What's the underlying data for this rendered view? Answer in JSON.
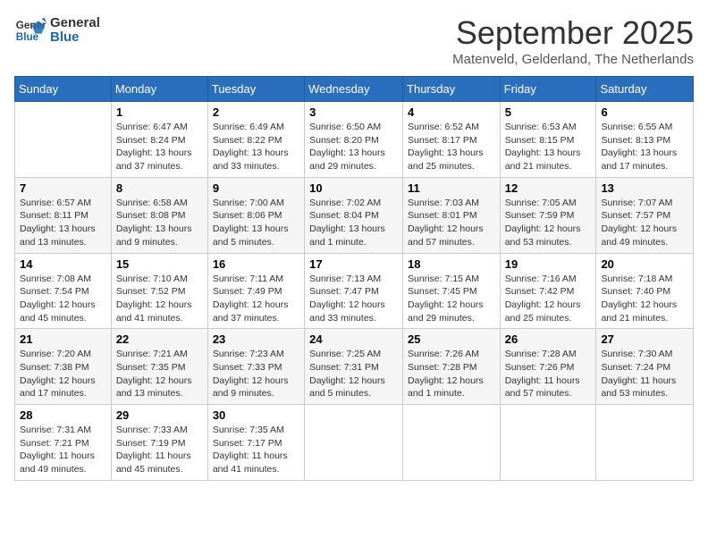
{
  "header": {
    "logo_line1": "General",
    "logo_line2": "Blue",
    "title": "September 2025",
    "subtitle": "Matenveld, Gelderland, The Netherlands"
  },
  "days_of_week": [
    "Sunday",
    "Monday",
    "Tuesday",
    "Wednesday",
    "Thursday",
    "Friday",
    "Saturday"
  ],
  "weeks": [
    [
      {
        "day": "",
        "info": ""
      },
      {
        "day": "1",
        "info": "Sunrise: 6:47 AM\nSunset: 8:24 PM\nDaylight: 13 hours\nand 37 minutes."
      },
      {
        "day": "2",
        "info": "Sunrise: 6:49 AM\nSunset: 8:22 PM\nDaylight: 13 hours\nand 33 minutes."
      },
      {
        "day": "3",
        "info": "Sunrise: 6:50 AM\nSunset: 8:20 PM\nDaylight: 13 hours\nand 29 minutes."
      },
      {
        "day": "4",
        "info": "Sunrise: 6:52 AM\nSunset: 8:17 PM\nDaylight: 13 hours\nand 25 minutes."
      },
      {
        "day": "5",
        "info": "Sunrise: 6:53 AM\nSunset: 8:15 PM\nDaylight: 13 hours\nand 21 minutes."
      },
      {
        "day": "6",
        "info": "Sunrise: 6:55 AM\nSunset: 8:13 PM\nDaylight: 13 hours\nand 17 minutes."
      }
    ],
    [
      {
        "day": "7",
        "info": "Sunrise: 6:57 AM\nSunset: 8:11 PM\nDaylight: 13 hours\nand 13 minutes."
      },
      {
        "day": "8",
        "info": "Sunrise: 6:58 AM\nSunset: 8:08 PM\nDaylight: 13 hours\nand 9 minutes."
      },
      {
        "day": "9",
        "info": "Sunrise: 7:00 AM\nSunset: 8:06 PM\nDaylight: 13 hours\nand 5 minutes."
      },
      {
        "day": "10",
        "info": "Sunrise: 7:02 AM\nSunset: 8:04 PM\nDaylight: 13 hours\nand 1 minute."
      },
      {
        "day": "11",
        "info": "Sunrise: 7:03 AM\nSunset: 8:01 PM\nDaylight: 12 hours\nand 57 minutes."
      },
      {
        "day": "12",
        "info": "Sunrise: 7:05 AM\nSunset: 7:59 PM\nDaylight: 12 hours\nand 53 minutes."
      },
      {
        "day": "13",
        "info": "Sunrise: 7:07 AM\nSunset: 7:57 PM\nDaylight: 12 hours\nand 49 minutes."
      }
    ],
    [
      {
        "day": "14",
        "info": "Sunrise: 7:08 AM\nSunset: 7:54 PM\nDaylight: 12 hours\nand 45 minutes."
      },
      {
        "day": "15",
        "info": "Sunrise: 7:10 AM\nSunset: 7:52 PM\nDaylight: 12 hours\nand 41 minutes."
      },
      {
        "day": "16",
        "info": "Sunrise: 7:11 AM\nSunset: 7:49 PM\nDaylight: 12 hours\nand 37 minutes."
      },
      {
        "day": "17",
        "info": "Sunrise: 7:13 AM\nSunset: 7:47 PM\nDaylight: 12 hours\nand 33 minutes."
      },
      {
        "day": "18",
        "info": "Sunrise: 7:15 AM\nSunset: 7:45 PM\nDaylight: 12 hours\nand 29 minutes."
      },
      {
        "day": "19",
        "info": "Sunrise: 7:16 AM\nSunset: 7:42 PM\nDaylight: 12 hours\nand 25 minutes."
      },
      {
        "day": "20",
        "info": "Sunrise: 7:18 AM\nSunset: 7:40 PM\nDaylight: 12 hours\nand 21 minutes."
      }
    ],
    [
      {
        "day": "21",
        "info": "Sunrise: 7:20 AM\nSunset: 7:38 PM\nDaylight: 12 hours\nand 17 minutes."
      },
      {
        "day": "22",
        "info": "Sunrise: 7:21 AM\nSunset: 7:35 PM\nDaylight: 12 hours\nand 13 minutes."
      },
      {
        "day": "23",
        "info": "Sunrise: 7:23 AM\nSunset: 7:33 PM\nDaylight: 12 hours\nand 9 minutes."
      },
      {
        "day": "24",
        "info": "Sunrise: 7:25 AM\nSunset: 7:31 PM\nDaylight: 12 hours\nand 5 minutes."
      },
      {
        "day": "25",
        "info": "Sunrise: 7:26 AM\nSunset: 7:28 PM\nDaylight: 12 hours\nand 1 minute."
      },
      {
        "day": "26",
        "info": "Sunrise: 7:28 AM\nSunset: 7:26 PM\nDaylight: 11 hours\nand 57 minutes."
      },
      {
        "day": "27",
        "info": "Sunrise: 7:30 AM\nSunset: 7:24 PM\nDaylight: 11 hours\nand 53 minutes."
      }
    ],
    [
      {
        "day": "28",
        "info": "Sunrise: 7:31 AM\nSunset: 7:21 PM\nDaylight: 11 hours\nand 49 minutes."
      },
      {
        "day": "29",
        "info": "Sunrise: 7:33 AM\nSunset: 7:19 PM\nDaylight: 11 hours\nand 45 minutes."
      },
      {
        "day": "30",
        "info": "Sunrise: 7:35 AM\nSunset: 7:17 PM\nDaylight: 11 hours\nand 41 minutes."
      },
      {
        "day": "",
        "info": ""
      },
      {
        "day": "",
        "info": ""
      },
      {
        "day": "",
        "info": ""
      },
      {
        "day": "",
        "info": ""
      }
    ]
  ]
}
